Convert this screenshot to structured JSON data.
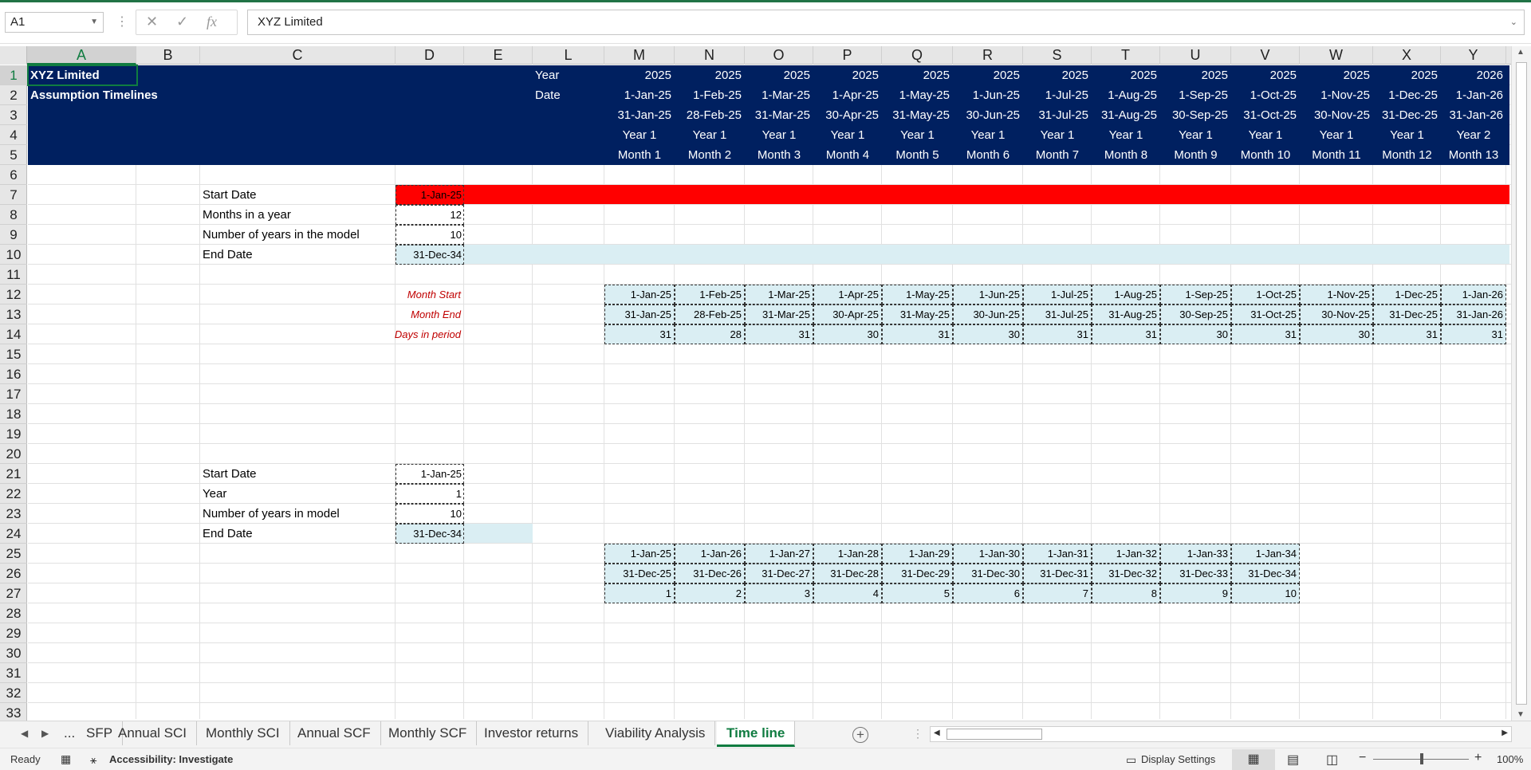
{
  "formula_bar": {
    "name_box": "A1",
    "cancel_icon": "✕",
    "enter_icon": "✓",
    "fx_label": "fx",
    "value": "XYZ Limited"
  },
  "columns": [
    "A",
    "B",
    "C",
    "D",
    "E",
    "L",
    "M",
    "N",
    "O",
    "P",
    "Q",
    "R",
    "S",
    "T",
    "U",
    "V",
    "W",
    "X",
    "Y"
  ],
  "rows": [
    "1",
    "2",
    "3",
    "4",
    "5",
    "6",
    "7",
    "8",
    "9",
    "10",
    "11",
    "12",
    "13",
    "14",
    "15",
    "16",
    "17",
    "18",
    "19",
    "20",
    "21",
    "22",
    "23",
    "24",
    "25",
    "26",
    "27",
    "28",
    "29",
    "30",
    "31",
    "32",
    "33"
  ],
  "header_band": {
    "title": "XYZ Limited",
    "subtitle": "Assumption Timelines",
    "year_label": "Year",
    "date_label": "Date",
    "years": [
      "2025",
      "2025",
      "2025",
      "2025",
      "2025",
      "2025",
      "2025",
      "2025",
      "2025",
      "2025",
      "2025",
      "2025",
      "2026"
    ],
    "start_dates": [
      "1-Jan-25",
      "1-Feb-25",
      "1-Mar-25",
      "1-Apr-25",
      "1-May-25",
      "1-Jun-25",
      "1-Jul-25",
      "1-Aug-25",
      "1-Sep-25",
      "1-Oct-25",
      "1-Nov-25",
      "1-Dec-25",
      "1-Jan-26"
    ],
    "end_dates": [
      "31-Jan-25",
      "28-Feb-25",
      "31-Mar-25",
      "30-Apr-25",
      "31-May-25",
      "30-Jun-25",
      "31-Jul-25",
      "31-Aug-25",
      "30-Sep-25",
      "31-Oct-25",
      "30-Nov-25",
      "31-Dec-25",
      "31-Jan-26"
    ],
    "year_nums": [
      "Year 1",
      "Year 1",
      "Year 1",
      "Year 1",
      "Year 1",
      "Year 1",
      "Year 1",
      "Year 1",
      "Year 1",
      "Year 1",
      "Year 1",
      "Year 1",
      "Year 2"
    ],
    "month_nums": [
      "Month 1",
      "Month 2",
      "Month 3",
      "Month 4",
      "Month 5",
      "Month 6",
      "Month 7",
      "Month 8",
      "Month 9",
      "Month 10",
      "Month 11",
      "Month 12",
      "Month 13"
    ]
  },
  "monthly_inputs": {
    "start_label": "Start Date",
    "start_value": "1-Jan-25",
    "months_label": "Months in a year",
    "months_value": "12",
    "years_label": "Number of years in the model",
    "years_value": "10",
    "end_label": "End Date",
    "end_value": "31-Dec-34"
  },
  "monthly_timeline": {
    "start_label": "Month Start",
    "end_label": "Month End",
    "days_label": "Days in period",
    "starts": [
      "1-Jan-25",
      "1-Feb-25",
      "1-Mar-25",
      "1-Apr-25",
      "1-May-25",
      "1-Jun-25",
      "1-Jul-25",
      "1-Aug-25",
      "1-Sep-25",
      "1-Oct-25",
      "1-Nov-25",
      "1-Dec-25",
      "1-Jan-26"
    ],
    "ends": [
      "31-Jan-25",
      "28-Feb-25",
      "31-Mar-25",
      "30-Apr-25",
      "31-May-25",
      "30-Jun-25",
      "31-Jul-25",
      "31-Aug-25",
      "30-Sep-25",
      "31-Oct-25",
      "30-Nov-25",
      "31-Dec-25",
      "31-Jan-26"
    ],
    "days": [
      "31",
      "28",
      "31",
      "30",
      "31",
      "30",
      "31",
      "31",
      "30",
      "31",
      "30",
      "31",
      "31"
    ]
  },
  "annual_inputs": {
    "start_label": "Start Date",
    "start_value": "1-Jan-25",
    "year_label": "Year",
    "year_value": "1",
    "years_label": "Number of years in model",
    "years_value": "10",
    "end_label": "End Date",
    "end_value": "31-Dec-34"
  },
  "annual_timeline": {
    "starts": [
      "1-Jan-25",
      "1-Jan-26",
      "1-Jan-27",
      "1-Jan-28",
      "1-Jan-29",
      "1-Jan-30",
      "1-Jan-31",
      "1-Jan-32",
      "1-Jan-33",
      "1-Jan-34"
    ],
    "ends": [
      "31-Dec-25",
      "31-Dec-26",
      "31-Dec-27",
      "31-Dec-28",
      "31-Dec-29",
      "31-Dec-30",
      "31-Dec-31",
      "31-Dec-32",
      "31-Dec-33",
      "31-Dec-34"
    ],
    "nums": [
      "1",
      "2",
      "3",
      "4",
      "5",
      "6",
      "7",
      "8",
      "9",
      "10"
    ]
  },
  "sheet_tabs": {
    "ellipsis": "...",
    "tabs": [
      "SFP",
      "Annual SCI",
      "Monthly SCI",
      "Annual SCF",
      "Monthly SCF",
      "Investor returns",
      "Viability Analysis",
      "Time line"
    ],
    "active": "Time line"
  },
  "status_bar": {
    "ready": "Ready",
    "accessibility": "Accessibility: Investigate",
    "display_settings": "Display Settings",
    "zoom": "100%"
  },
  "colors": {
    "header_band": "#002060",
    "input_highlight": "#ff0000",
    "calc_fill": "#daeef3",
    "label_red": "#c00000",
    "excel_green": "#107c41"
  }
}
